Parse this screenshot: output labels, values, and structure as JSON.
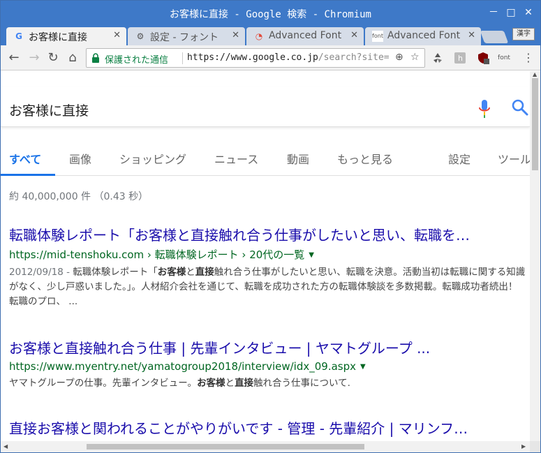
{
  "window": {
    "title": "お客様に直接 - Google 検索 - Chromium",
    "minimize": "－",
    "maximize": "□",
    "close": "✕"
  },
  "tabs": [
    {
      "favicon": "G",
      "label": "お客様に直接",
      "close": "✕"
    },
    {
      "favicon": "⚙",
      "label": "設定 - フォント",
      "close": "✕"
    },
    {
      "favicon": "◔",
      "label": "Advanced Font",
      "close": "✕"
    },
    {
      "favicon": "font",
      "label": "Advanced Font",
      "close": "✕"
    }
  ],
  "ime_label": "漢字",
  "toolbar": {
    "back": "←",
    "forward": "→",
    "reload": "↻",
    "home": "⌂",
    "secure_label": "保護された通信",
    "url_scheme": "https://",
    "url_host": "www.google.co.jp",
    "url_path": "/search?site=&sour",
    "zoom_icon": "⊕",
    "star_icon": "☆",
    "menu_icon": "⋮",
    "ext_font_label": "font"
  },
  "search": {
    "query": "お客様に直接"
  },
  "search_tabs": [
    "すべて",
    "画像",
    "ショッピング",
    "ニュース",
    "動画",
    "もっと見る",
    "設定",
    "ツール"
  ],
  "stats": "約 40,000,000 件 （0.43 秒）",
  "results": [
    {
      "title": "転職体験レポート「お客様と直接触れ合う仕事がしたいと思い、転職を…",
      "url": "https://mid-tenshoku.com › 転職体験レポート › 20代の一覧",
      "date": "2012/09/18 - ",
      "snippet_a": "転職体験レポート「",
      "snippet_b1": "お客様",
      "snippet_c": "と",
      "snippet_b2": "直接",
      "snippet_d": "触れ合う仕事がしたいと思い、転職を決意。活動当初は転職に関する知識がなく、少し戸惑いました。」。人材紹介会社を通じて、転職を成功された方の転職体験談を多数掲載。転職成功者続出！転職のプロ、 ..."
    },
    {
      "title": "お客様と直接触れ合う仕事 | 先輩インタビュー | ヤマトグループ ...",
      "url": "https://www.myentry.net/yamatogroup2018/interview/idx_09.aspx",
      "snippet_a": "ヤマトグループの仕事。先輩インタビュー。",
      "snippet_b1": "お客様",
      "snippet_c": "と",
      "snippet_b2": "直接",
      "snippet_d": "触れ合う仕事について."
    },
    {
      "title": "直接お客様と関われることがやりがいです - 管理 - 先輩紹介 | マリンフ…"
    }
  ],
  "colors": {
    "titlebar": "#3e79c8",
    "link": "#1a0dab",
    "url_green": "#006621",
    "accent": "#1a73e8"
  }
}
